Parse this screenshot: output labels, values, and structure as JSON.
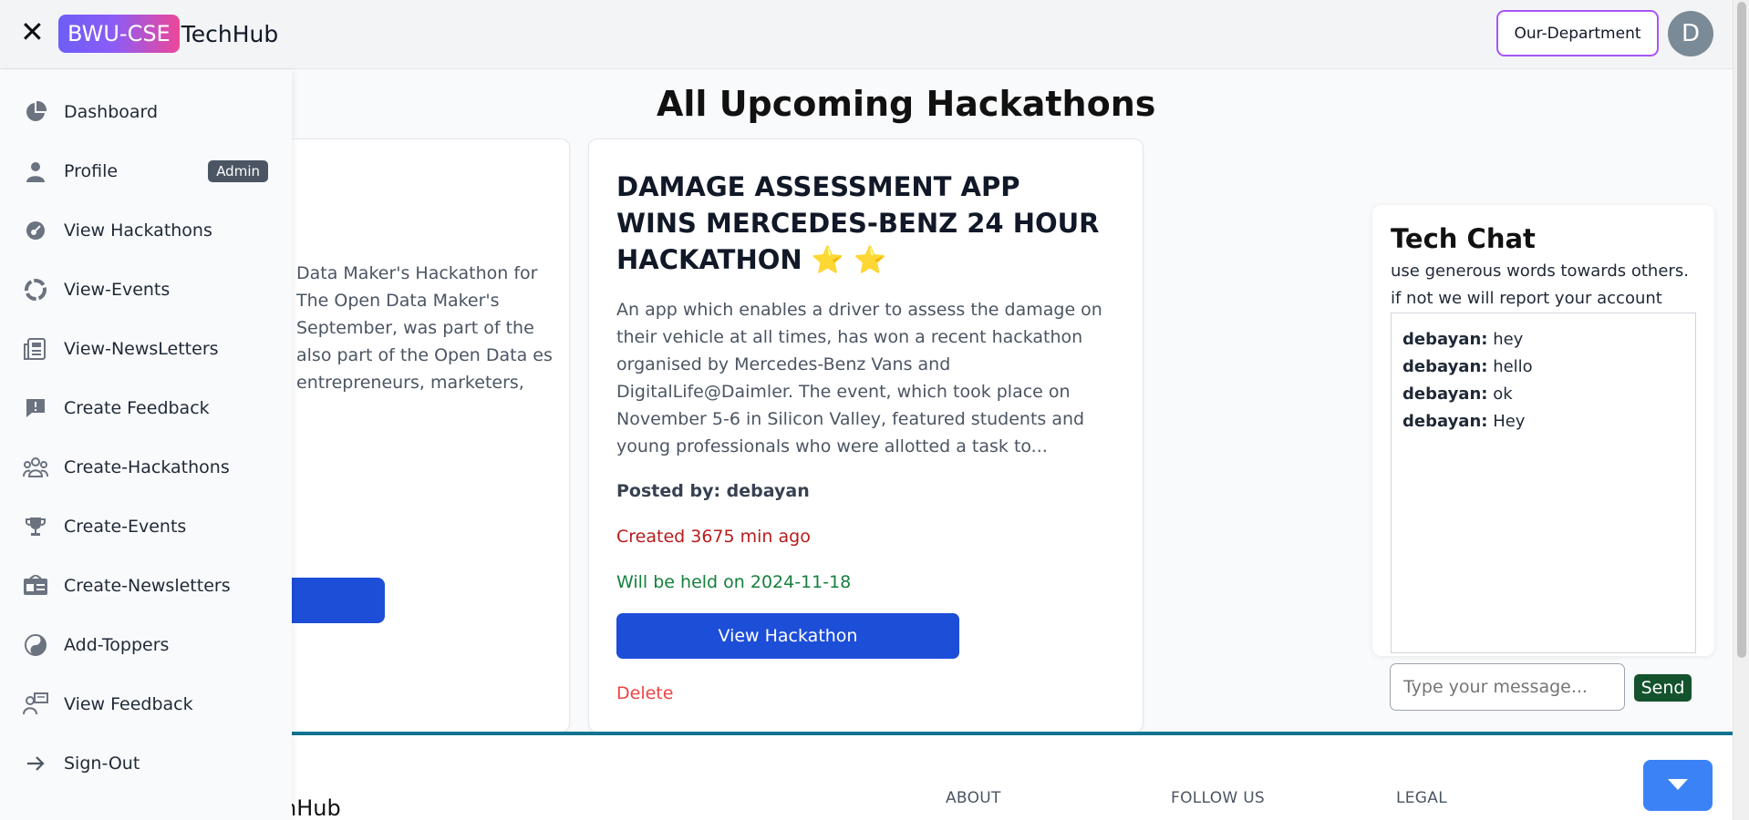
{
  "header": {
    "close_symbol": "✕",
    "brand_badge": "BWU-CSE",
    "brand_text": "TechHub",
    "department_button": "Our-Department",
    "avatar_initial": "D"
  },
  "sidebar": {
    "items": [
      {
        "label": "Dashboard",
        "icon": "pie-chart-icon"
      },
      {
        "label": "Profile",
        "icon": "user-icon",
        "badge": "Admin"
      },
      {
        "label": "View Hackathons",
        "icon": "hackathon-icon"
      },
      {
        "label": "View-Events",
        "icon": "events-icon"
      },
      {
        "label": "View-NewsLetters",
        "icon": "newspaper-icon"
      },
      {
        "label": "Create Feedback",
        "icon": "feedback-icon"
      },
      {
        "label": "Create-Hackathons",
        "icon": "team-icon"
      },
      {
        "label": "Create-Events",
        "icon": "trophy-icon"
      },
      {
        "label": "Create-Newsletters",
        "icon": "newsletter-icon"
      },
      {
        "label": "Add-Toppers",
        "icon": "yin-yang-icon"
      },
      {
        "label": "View Feedback",
        "icon": "user-feedback-icon"
      },
      {
        "label": "Sign-Out",
        "icon": "arrow-right-icon"
      }
    ]
  },
  "main": {
    "title": "All Upcoming Hackathons",
    "left_card": {
      "description": "Data Maker's Hackathon for The Open Data Maker's September, was part of the also part of the Open Data es entrepreneurs, marketers,"
    },
    "card": {
      "title": "DAMAGE ASSESSMENT APP WINS MERCEDES-BENZ 24 HOUR HACKATHON ⭐ ⭐",
      "description": "An app which enables a driver to assess the damage on their vehicle at all times, has won a recent hackathon organised by Mercedes-Benz Vans and DigitalLife@Daimler. The event, which took place on November 5-6 in Silicon Valley, featured students and young professionals who were allotted a task to...",
      "posted_by": "Posted by: debayan",
      "created": "Created 3675 min ago",
      "held_on": "Will be held on 2024-11-18",
      "view_button": "View Hackathon",
      "delete_label": "Delete"
    }
  },
  "chat": {
    "title": "Tech Chat",
    "warning_line1": "use generous words towards others.",
    "warning_line2": "if not we will report your account",
    "messages": [
      {
        "user": "debayan:",
        "text": " hey"
      },
      {
        "user": "debayan:",
        "text": " hello"
      },
      {
        "user": "debayan:",
        "text": " ok"
      },
      {
        "user": "debayan:",
        "text": " Hey"
      }
    ],
    "input_placeholder": "Type your message...",
    "send_label": "Send"
  },
  "footer": {
    "brand_partial": "nHub",
    "columns": [
      "ABOUT",
      "FOLLOW US",
      "LEGAL"
    ]
  },
  "colors": {
    "primary_blue": "#1d4ed8",
    "danger_red": "#ef4444",
    "created_red": "#b91c1c",
    "success_green": "#15803d",
    "send_green": "#14532d",
    "footer_teal": "#0e7490"
  }
}
